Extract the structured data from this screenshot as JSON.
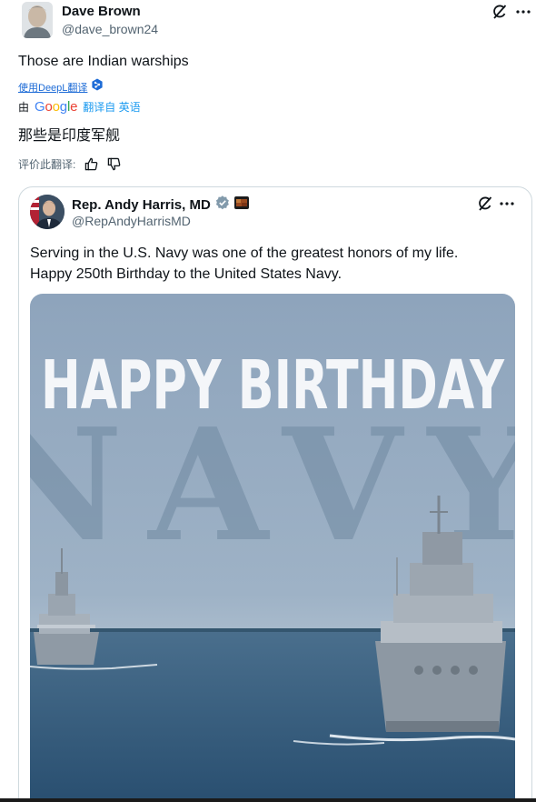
{
  "post": {
    "author_name": "Dave Brown",
    "author_handle": "@dave_brown24",
    "text": "Those are Indian warships",
    "deepl_link": "使用DeepL翻译",
    "google_prefix": "由",
    "google_word": "Google",
    "google_link": "翻译自 英语",
    "translated_text": "那些是印度军舰",
    "rate_label": "评价此翻译:"
  },
  "quote": {
    "author_name": "Rep. Andy Harris, MD",
    "author_handle": "@RepAndyHarrisMD",
    "text_line1": "Serving in the U.S. Navy was one of the greatest honors of my life.",
    "text_line2": "Happy 250th Birthday to the United States Navy.",
    "image_headline": "HAPPY BIRTHDAY",
    "image_subline": "NAVY"
  },
  "colors": {
    "accent": "#1d9bf0",
    "verified": "#829aab",
    "sky": "#7f98b3",
    "sea": "#2d5575"
  }
}
